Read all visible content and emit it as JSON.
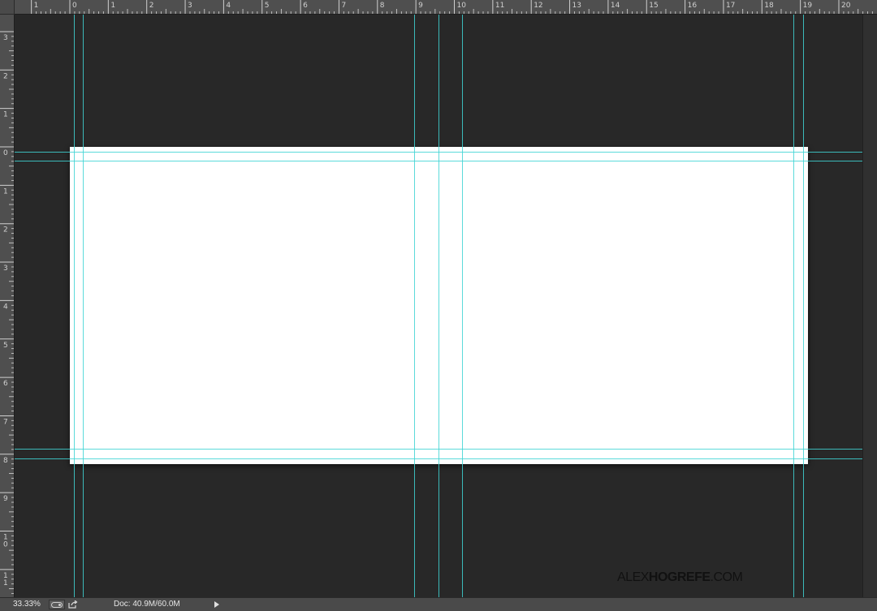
{
  "rulers": {
    "top_labels": [
      "1",
      "0",
      "1",
      "2",
      "3",
      "4",
      "5",
      "6",
      "7",
      "8",
      "9",
      "10",
      "11",
      "12",
      "13",
      "14",
      "15",
      "16",
      "17",
      "18",
      "19",
      "20"
    ],
    "left_labels": [
      "3",
      "2",
      "1",
      "0",
      "1",
      "2",
      "3",
      "4",
      "5",
      "6",
      "7",
      "8",
      "9",
      "10",
      "11"
    ]
  },
  "watermark": {
    "light_text": "ALEX",
    "bold_text": "HOGREFE",
    "suffix": ".COM"
  },
  "statusbar": {
    "zoom": "33.33%",
    "doc_info": "Doc: 40.9M/60.0M"
  },
  "colors": {
    "guide": "#3fd4d4",
    "canvas_bg": "#282828",
    "document": "#ffffff"
  }
}
